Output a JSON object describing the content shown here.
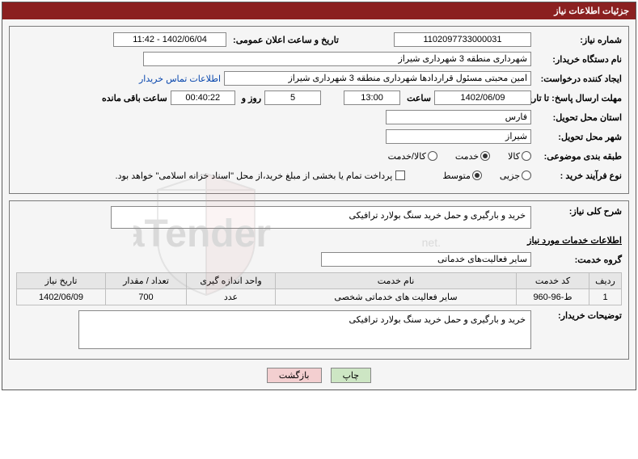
{
  "header": {
    "title": "جزئیات اطلاعات نیاز"
  },
  "labels": {
    "need_no": "شماره نیاز:",
    "announce_dt": "تاریخ و ساعت اعلان عمومی:",
    "buyer_org": "نام دستگاه خریدار:",
    "requester": "ایجاد کننده درخواست:",
    "contact_link": "اطلاعات تماس خریدار",
    "deadline": "مهلت ارسال پاسخ: تا تاریخ:",
    "at": "ساعت",
    "days_and": "روز و",
    "remaining": "ساعت باقی مانده",
    "delivery_province": "استان محل تحویل:",
    "delivery_city": "شهر محل تحویل:",
    "subject_class": "طبقه بندی موضوعی:",
    "class_goods": "کالا",
    "class_service": "خدمت",
    "class_goods_service": "کالا/خدمت",
    "purchase_type": "نوع فرآیند خرید :",
    "type_minor": "جزیی",
    "type_medium": "متوسط",
    "payment_note": "پرداخت تمام یا بخشی از مبلغ خرید،از محل \"اسناد خزانه اسلامی\" خواهد بود.",
    "need_summary": "شرح کلی نیاز:",
    "service_info": "اطلاعات خدمات مورد نیاز",
    "service_group": "گروه خدمت:",
    "buyer_notes": "توضیحات خریدار:"
  },
  "fields": {
    "need_no": "1102097733000031",
    "announce_dt": "1402/06/04 - 11:42",
    "buyer_org": "شهرداری منطقه 3 شهرداری شیراز",
    "requester": "امین محبتی مسئول قراردادها شهرداری منطقه 3 شهرداری شیراز",
    "deadline_date": "1402/06/09",
    "deadline_time": "13:00",
    "days_left": "5",
    "time_left": "00:40:22",
    "province": "فارس",
    "city": "شیراز",
    "need_summary": "خرید و بارگیری و حمل خرید  سنگ بولارد ترافیکی",
    "service_group": "سایر فعالیت‌های خدماتی",
    "buyer_notes": "خرید و بارگیری و حمل خرید  سنگ بولارد ترافیکی"
  },
  "table": {
    "headers": {
      "row": "ردیف",
      "code": "کد خدمت",
      "name": "نام خدمت",
      "unit": "واحد اندازه گیری",
      "qty": "تعداد / مقدار",
      "date": "تاریخ نیاز"
    },
    "rows": [
      {
        "row": "1",
        "code": "ط-96-960",
        "name": "سایر فعالیت های خدماتی شخصی",
        "unit": "عدد",
        "qty": "700",
        "date": "1402/06/09"
      }
    ]
  },
  "buttons": {
    "print": "چاپ",
    "back": "بازگشت"
  }
}
